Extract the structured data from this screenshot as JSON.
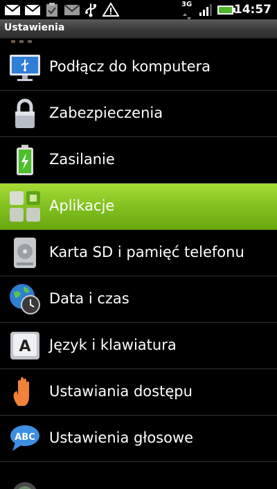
{
  "status_bar": {
    "network": "3G",
    "time": "14:57"
  },
  "title_bar": {
    "title": "Ustawienia"
  },
  "settings_list": {
    "items": [
      {
        "label": "Podłącz do komputera",
        "icon": "computer-usb-icon"
      },
      {
        "label": "Zabezpieczenia",
        "icon": "padlock-icon"
      },
      {
        "label": "Zasilanie",
        "icon": "battery-icon"
      },
      {
        "label": "Aplikacje",
        "icon": "applications-icon",
        "selected": true
      },
      {
        "label": "Karta SD i pamięć telefonu",
        "icon": "sd-storage-icon"
      },
      {
        "label": "Data i czas",
        "icon": "globe-clock-icon"
      },
      {
        "label": "Język i klawiatura",
        "icon": "keyboard-key-icon"
      },
      {
        "label": "Ustawiania dostępu",
        "icon": "hand-icon"
      },
      {
        "label": "Ustawienia głosowe",
        "icon": "abc-speech-bubble-icon"
      }
    ]
  },
  "colors": {
    "selected_row": "#8cc82a",
    "background": "#000000",
    "divider": "#333333"
  }
}
